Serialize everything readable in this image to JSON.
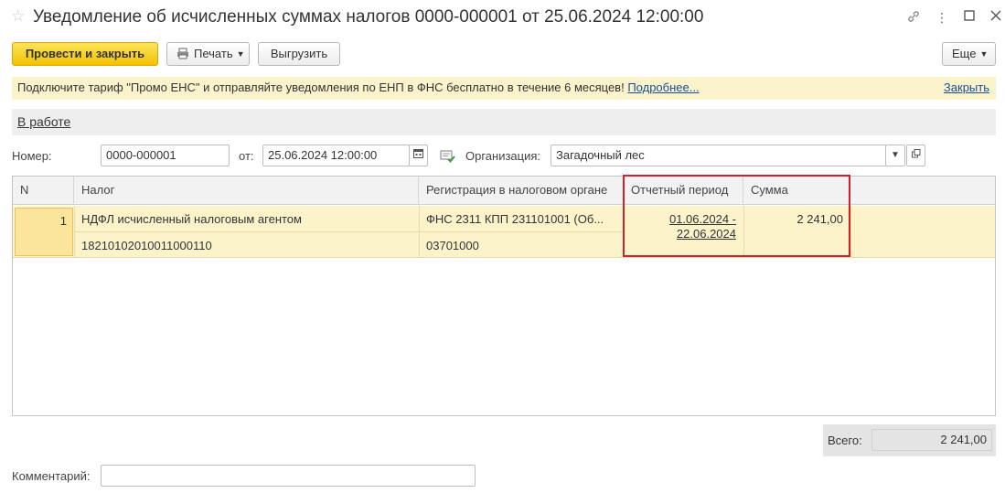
{
  "window": {
    "title": "Уведомление об исчисленных суммах налогов 0000-000001 от 25.06.2024 12:00:00",
    "controls": [
      "link-icon",
      "more-icon",
      "maximize-icon",
      "close-icon"
    ]
  },
  "toolbar": {
    "post_close_label": "Провести и закрыть",
    "print_label": "Печать",
    "export_label": "Выгрузить",
    "more_label": "Еще"
  },
  "infobar": {
    "text": "Подключите тариф \"Промо ЕНС\" и отправляйте уведомления по ЕНП в ФНС бесплатно в течение 6 месяцев!",
    "more_link": "Подробнее...",
    "close_link": "Закрыть"
  },
  "status": {
    "label": "В работе"
  },
  "form": {
    "number_label": "Номер:",
    "number_value": "0000-000001",
    "date_label": "от:",
    "date_value": "25.06.2024 12:00:00",
    "org_label": "Организация:",
    "org_value": "Загадочный лес"
  },
  "table": {
    "columns": [
      "N",
      "Налог",
      "Регистрация в налоговом органе",
      "Отчетный период",
      "Сумма"
    ],
    "rows": [
      {
        "n": "1",
        "tax_name": "НДФЛ исчисленный налоговым агентом",
        "kbk": "18210102010011000110",
        "registration": "ФНС 2311 КПП 231101001 (Об...",
        "oktmo": "03701000",
        "period_line1": "01.06.2024 -",
        "period_line2": "22.06.2024",
        "amount": "2 241,00"
      }
    ]
  },
  "totals": {
    "label": "Всего:",
    "value": "2 241,00"
  },
  "comment": {
    "label": "Комментарий:",
    "value": ""
  },
  "colors": {
    "primary_button": "#f2c200",
    "infobar_bg": "#fbf3cb",
    "row_selected": "#fdf3cb",
    "highlight_frame": "#d0202a"
  }
}
